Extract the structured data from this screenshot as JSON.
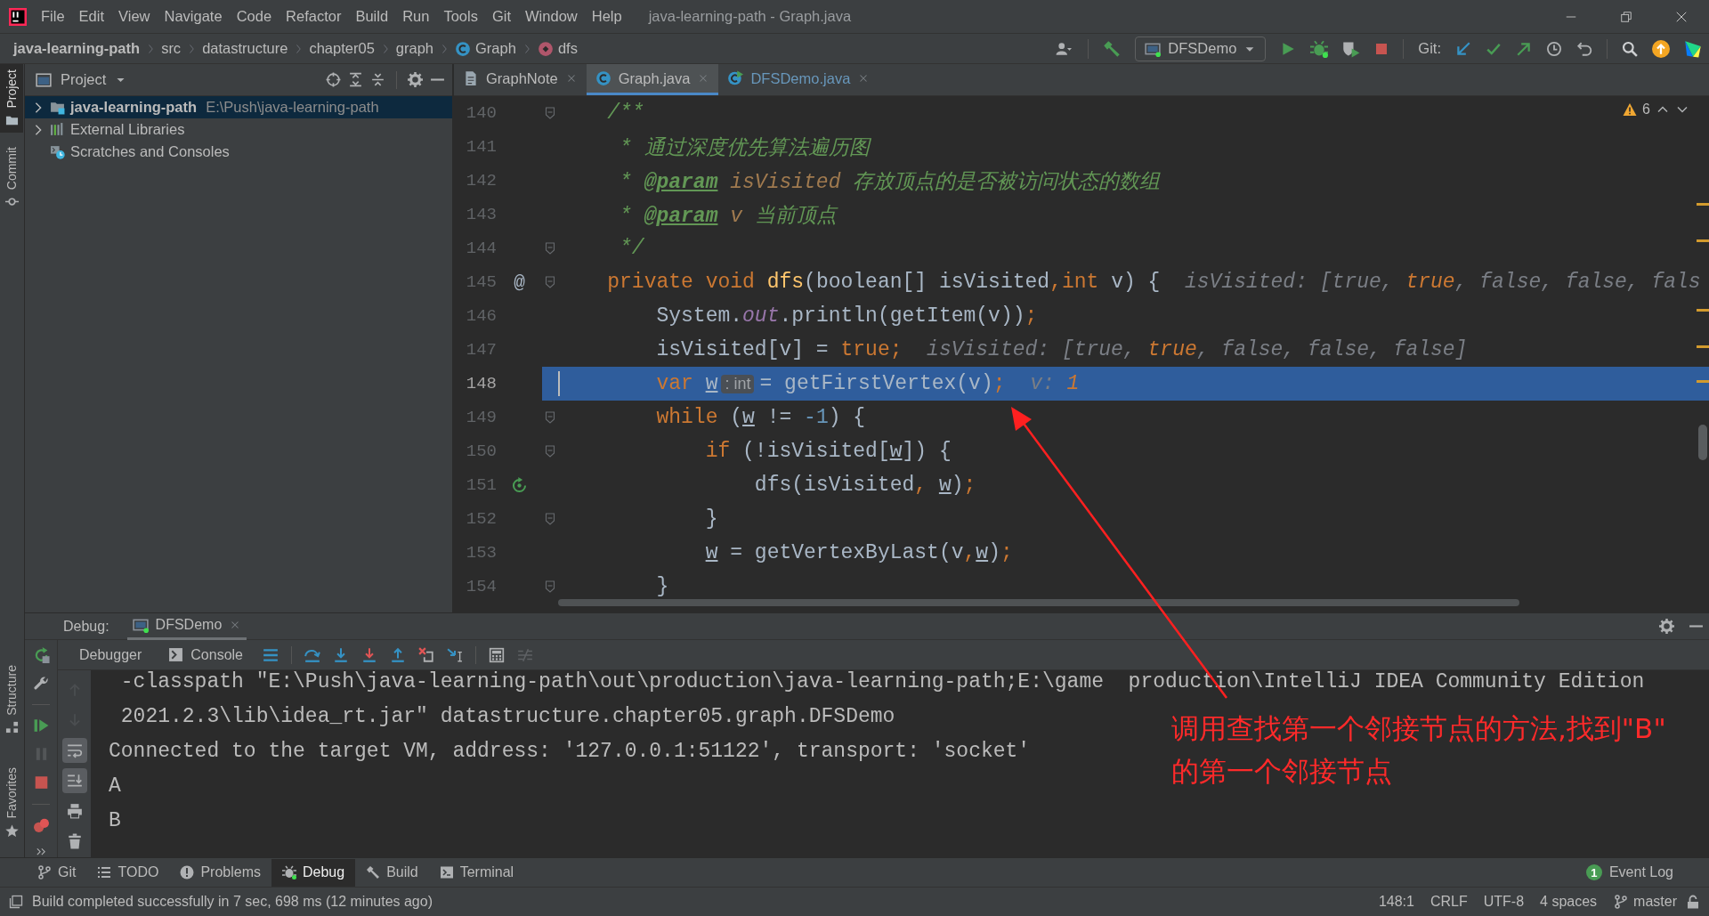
{
  "title_bar": {
    "menu": [
      "File",
      "Edit",
      "View",
      "Navigate",
      "Code",
      "Refactor",
      "Build",
      "Run",
      "Tools",
      "Git",
      "Window",
      "Help"
    ],
    "title": "java-learning-path - Graph.java"
  },
  "nav_bar": {
    "breadcrumbs": [
      {
        "label": "java-learning-path",
        "kind": "project"
      },
      {
        "label": "src",
        "kind": "folder"
      },
      {
        "label": "datastructure",
        "kind": "folder"
      },
      {
        "label": "chapter05",
        "kind": "folder"
      },
      {
        "label": "graph",
        "kind": "folder"
      },
      {
        "label": "Graph",
        "kind": "class"
      },
      {
        "label": "dfs",
        "kind": "method"
      }
    ],
    "run_config": "DFSDemo",
    "git_label": "Git:"
  },
  "side_stripe": {
    "top": [
      {
        "label": "Project",
        "kind": "project",
        "selected": true
      },
      {
        "label": "Commit",
        "kind": "commit",
        "selected": false
      }
    ],
    "bottom": [
      {
        "label": "Structure",
        "kind": "structure",
        "selected": false
      },
      {
        "label": "Favorites",
        "kind": "favorites",
        "selected": false
      }
    ]
  },
  "project_panel": {
    "title": "Project",
    "tree": [
      {
        "label": "java-learning-path",
        "path": "E:\\Push\\java-learning-path",
        "kind": "module",
        "expanded": false,
        "selected": true
      },
      {
        "label": "External Libraries",
        "kind": "libraries",
        "expanded": false,
        "selected": false
      },
      {
        "label": "Scratches and Consoles",
        "kind": "scratches",
        "selected": false
      }
    ]
  },
  "editor": {
    "tabs": [
      {
        "label": "GraphNote",
        "kind": "note",
        "selected": false,
        "modified": false
      },
      {
        "label": "Graph.java",
        "kind": "class",
        "selected": true,
        "modified": false
      },
      {
        "label": "DFSDemo.java",
        "kind": "runnable",
        "selected": false,
        "modified": true
      }
    ],
    "problems": "6",
    "lines": [
      {
        "number": "140",
        "selected": false,
        "fold": true,
        "tokens": [
          {
            "kind": "comment",
            "t": "    /**"
          }
        ]
      },
      {
        "number": "141",
        "selected": false,
        "fold": false,
        "tokens": [
          {
            "kind": "comment",
            "t": "     * 通过深度优先算法遍历图"
          }
        ]
      },
      {
        "number": "142",
        "selected": false,
        "fold": false,
        "tokens": [
          {
            "kind": "comment",
            "t": "     * "
          },
          {
            "kind": "doctag",
            "t": "@param"
          },
          {
            "kind": "docparam",
            "t": " isVisited"
          },
          {
            "kind": "comment",
            "t": " 存放顶点的是否被访问状态的数组"
          }
        ]
      },
      {
        "number": "143",
        "selected": false,
        "fold": false,
        "tokens": [
          {
            "kind": "comment",
            "t": "     * "
          },
          {
            "kind": "doctag",
            "t": "@param"
          },
          {
            "kind": "docparam",
            "t": " v"
          },
          {
            "kind": "comment",
            "t": " 当前顶点"
          }
        ]
      },
      {
        "number": "144",
        "selected": false,
        "fold": true,
        "tokens": [
          {
            "kind": "comment",
            "t": "     */"
          }
        ]
      },
      {
        "number": "145",
        "selected": false,
        "fold": true,
        "gutter": "@",
        "tokens": [
          {
            "kind": "keyword",
            "t": "    private void "
          },
          {
            "kind": "function",
            "t": "dfs"
          },
          {
            "kind": "plain",
            "t": "(boolean[] isVisited"
          },
          {
            "kind": "keyword",
            "t": ",int"
          },
          {
            "kind": "plain",
            "t": " v) {"
          },
          {
            "kind": "hint",
            "t": "isVisited: [true, "
          },
          {
            "kind": "hintchanged",
            "t": "true"
          },
          {
            "kind": "hint",
            "t": ", false, false, fals"
          }
        ]
      },
      {
        "number": "146",
        "selected": false,
        "fold": false,
        "tokens": [
          {
            "kind": "plain",
            "t": "        System."
          },
          {
            "kind": "static",
            "t": "out"
          },
          {
            "kind": "plain",
            "t": ".println(getItem(v))"
          },
          {
            "kind": "keyword",
            "t": ";"
          }
        ]
      },
      {
        "number": "147",
        "selected": false,
        "fold": false,
        "tokens": [
          {
            "kind": "plain",
            "t": "        isVisited[v] = "
          },
          {
            "kind": "keyword",
            "t": "true;"
          },
          {
            "kind": "hint",
            "t": "isVisited: [true, "
          },
          {
            "kind": "hintchanged",
            "t": "true"
          },
          {
            "kind": "hint",
            "t": ", false, false, false]"
          }
        ]
      },
      {
        "number": "148",
        "selected": true,
        "fold": false,
        "tokens": [
          {
            "kind": "keyword",
            "t": "        var "
          },
          {
            "kind": "variable",
            "t": "w"
          },
          {
            "kind": "inlay",
            "t": ": int"
          },
          {
            "kind": "plain",
            "t": "= getFirstVertex(v)"
          },
          {
            "kind": "keyword",
            "t": ";"
          },
          {
            "kind": "hint",
            "t": "v: "
          },
          {
            "kind": "hintchanged",
            "t": "1"
          }
        ]
      },
      {
        "number": "149",
        "selected": false,
        "fold": true,
        "tokens": [
          {
            "kind": "keyword",
            "t": "        while"
          },
          {
            "kind": "plain",
            "t": " ("
          },
          {
            "kind": "variable",
            "t": "w"
          },
          {
            "kind": "plain",
            "t": " != "
          },
          {
            "kind": "number",
            "t": "-1"
          },
          {
            "kind": "plain",
            "t": ") {"
          }
        ]
      },
      {
        "number": "150",
        "selected": false,
        "fold": true,
        "tokens": [
          {
            "kind": "keyword",
            "t": "            if"
          },
          {
            "kind": "plain",
            "t": " (!isVisited["
          },
          {
            "kind": "variable",
            "t": "w"
          },
          {
            "kind": "plain",
            "t": "]) {"
          }
        ]
      },
      {
        "number": "151",
        "selected": false,
        "fold": false,
        "recursion_marker": true,
        "tokens": [
          {
            "kind": "plain",
            "t": "                dfs(isVisited"
          },
          {
            "kind": "keyword",
            "t": ", "
          },
          {
            "kind": "variable",
            "t": "w"
          },
          {
            "kind": "plain",
            "t": ")"
          },
          {
            "kind": "keyword",
            "t": ";"
          }
        ]
      },
      {
        "number": "152",
        "selected": false,
        "fold": true,
        "tokens": [
          {
            "kind": "plain",
            "t": "            }"
          }
        ]
      },
      {
        "number": "153",
        "selected": false,
        "fold": false,
        "tokens": [
          {
            "kind": "variable",
            "t": "            w"
          },
          {
            "kind": "plain",
            "t": " = getVertexByLast(v"
          },
          {
            "kind": "keyword",
            "t": ","
          },
          {
            "kind": "variable",
            "t": "w"
          },
          {
            "kind": "plain",
            "t": ")"
          },
          {
            "kind": "keyword",
            "t": ";"
          }
        ]
      },
      {
        "number": "154",
        "selected": false,
        "fold": true,
        "tokens": [
          {
            "kind": "plain",
            "t": "        }"
          }
        ]
      }
    ]
  },
  "debug": {
    "title": "Debug:",
    "session": "DFSDemo",
    "view_tabs": [
      "Debugger",
      "Console"
    ],
    "actions": [
      {
        "kind": "rerun",
        "disabled": false
      },
      {
        "kind": "settings",
        "disabled": false
      },
      {
        "kind": "resume",
        "disabled": false
      },
      {
        "kind": "pause",
        "disabled": true
      },
      {
        "kind": "stop",
        "disabled": false
      },
      {
        "kind": "mute-breakpoints",
        "disabled": false
      },
      {
        "kind": "more",
        "disabled": false
      }
    ],
    "side_tools": [
      {
        "kind": "up",
        "disabled": true,
        "on": false
      },
      {
        "kind": "down",
        "disabled": true,
        "on": false
      },
      {
        "kind": "soft-wrap",
        "disabled": false,
        "on": true
      },
      {
        "kind": "scroll-to-end",
        "disabled": false,
        "on": true
      },
      {
        "kind": "print",
        "disabled": false,
        "on": false
      },
      {
        "kind": "clear",
        "disabled": false,
        "on": false
      }
    ],
    "console": [
      " -classpath \"E:\\Push\\java-learning-path\\out\\production\\java-learning-path;E:\\game  production\\IntelliJ IDEA Community Edition",
      " 2021.2.3\\lib\\idea_rt.jar\" datastructure.chapter05.graph.DFSDemo",
      "Connected to the target VM, address: '127.0.0.1:51122', transport: 'socket'",
      "A",
      "B"
    ]
  },
  "tool_tabs": [
    {
      "label": "Git",
      "kind": "git",
      "selected": false
    },
    {
      "label": "TODO",
      "kind": "todo",
      "selected": false
    },
    {
      "label": "Problems",
      "kind": "problems",
      "selected": false
    },
    {
      "label": "Debug",
      "kind": "debug",
      "selected": true
    },
    {
      "label": "Build",
      "kind": "build",
      "selected": false
    },
    {
      "label": "Terminal",
      "kind": "terminal",
      "selected": false
    }
  ],
  "event_log": {
    "label": "Event Log",
    "count": "1"
  },
  "status_bar": {
    "message": "Build completed successfully in 7 sec, 698 ms (12 minutes ago)",
    "items": [
      "148:1",
      "CRLF",
      "UTF-8",
      "4 spaces"
    ],
    "branch": "master"
  },
  "annotation": {
    "text": "调用查找第一个邻接节点的方法,找到\"B\"\n的第一个邻接节点"
  }
}
